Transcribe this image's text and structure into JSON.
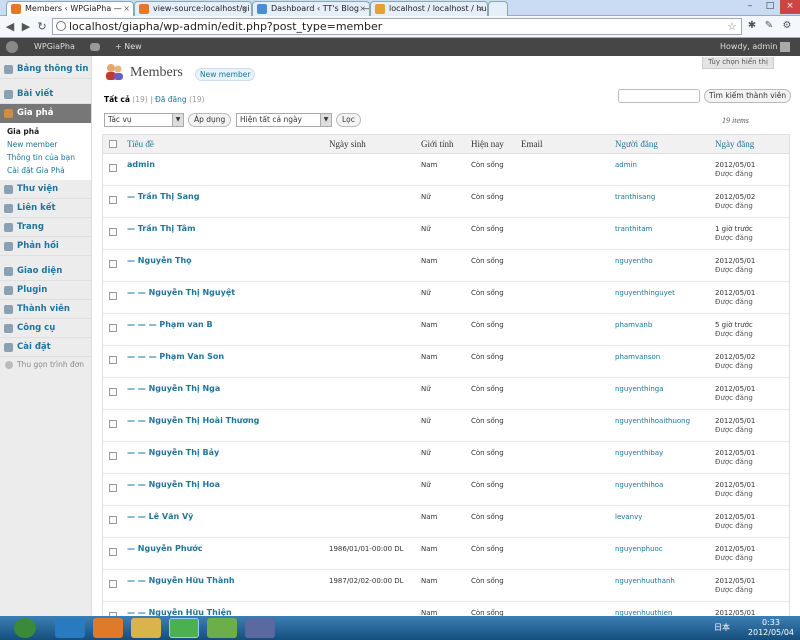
{
  "browser": {
    "tabs": [
      {
        "title": "Members ‹ WPGiaPha —",
        "color": "#e07a2a",
        "active": true
      },
      {
        "title": "view-source:localhost/gi",
        "color": "#e07a2a"
      },
      {
        "title": "Dashboard ‹ TT's Blog —",
        "color": "#4a8fd0"
      },
      {
        "title": "localhost / localhost / hu",
        "color": "#e8a030"
      }
    ],
    "url": "localhost/giapha/wp-admin/edit.php?post_type=member"
  },
  "admin_bar": {
    "site": "WPGiaPha",
    "new": "+ New",
    "howdy": "Howdy, admin"
  },
  "sidebar": {
    "items": [
      {
        "label": "Bảng thông tin"
      },
      {
        "label": "Bài viết"
      },
      {
        "label": "Gia phả"
      },
      {
        "label": "Thư viện"
      },
      {
        "label": "Liên kết"
      },
      {
        "label": "Trang"
      },
      {
        "label": "Phản hồi"
      },
      {
        "label": "Giao diện"
      },
      {
        "label": "Plugin"
      },
      {
        "label": "Thành viên"
      },
      {
        "label": "Công cụ"
      },
      {
        "label": "Cài đặt"
      }
    ],
    "submenu": [
      "Gia phả",
      "New member",
      "Thông tin của bạn",
      "Cài đặt Gia Phả"
    ],
    "collapse": "Thu gọn trình đơn"
  },
  "page": {
    "title": "Members",
    "add_new": "New member",
    "screen_options": "Tùy chọn hiển thị",
    "filter_all": "Tất cả",
    "filter_all_count": "(19)",
    "filter_sep": "|",
    "filter_pub": "Đã đăng",
    "filter_pub_count": "(19)",
    "search_button": "Tìm kiếm thành viên",
    "bulk_action": "Tác vụ",
    "apply": "Áp dụng",
    "date_filter": "Hiện tất cả ngày",
    "filter_btn": "Lọc",
    "items_count": "19 items"
  },
  "table": {
    "headers": {
      "title": "Tiêu đề",
      "birth": "Ngày sinh",
      "gender": "Giới tính",
      "status": "Hiện nay",
      "email": "Email",
      "author": "Người đăng",
      "date": "Ngày đăng"
    },
    "rows": [
      {
        "title": "admin",
        "birth": "",
        "gender": "Nam",
        "status": "Còn sống",
        "author": "admin",
        "date": "2012/05/01",
        "state": "Được đăng"
      },
      {
        "title": "— Trần Thị Sang",
        "birth": "",
        "gender": "Nữ",
        "status": "Còn sống",
        "author": "tranthisang",
        "date": "2012/05/02",
        "state": "Được đăng"
      },
      {
        "title": "— Trần Thị Tâm",
        "birth": "",
        "gender": "Nữ",
        "status": "Còn sống",
        "author": "tranthitam",
        "date": "1 giờ trước",
        "state": "Được đăng"
      },
      {
        "title": "— Nguyễn Thọ",
        "birth": "",
        "gender": "Nam",
        "status": "Còn sống",
        "author": "nguyentho",
        "date": "2012/05/01",
        "state": "Được đăng"
      },
      {
        "title": "— — Nguyễn Thị Nguyệt",
        "birth": "",
        "gender": "Nữ",
        "status": "Còn sống",
        "author": "nguyenthinguyet",
        "date": "2012/05/01",
        "state": "Được đăng"
      },
      {
        "title": "— — — Phạm van B",
        "birth": "",
        "gender": "Nam",
        "status": "Còn sống",
        "author": "phamvanb",
        "date": "5 giờ trước",
        "state": "Được đăng"
      },
      {
        "title": "— — — Phạm Van Son",
        "birth": "",
        "gender": "Nam",
        "status": "Còn sống",
        "author": "phamvanson",
        "date": "2012/05/02",
        "state": "Được đăng"
      },
      {
        "title": "— — Nguyễn Thị Nga",
        "birth": "",
        "gender": "Nữ",
        "status": "Còn sống",
        "author": "nguyenthinga",
        "date": "2012/05/01",
        "state": "Được đăng"
      },
      {
        "title": "— — Nguyễn Thị Hoài Thương",
        "birth": "",
        "gender": "Nữ",
        "status": "Còn sống",
        "author": "nguyenthihoaithuong",
        "date": "2012/05/01",
        "state": "Được đăng"
      },
      {
        "title": "— — Nguyễn Thị Bảy",
        "birth": "",
        "gender": "Nữ",
        "status": "Còn sống",
        "author": "nguyenthibay",
        "date": "2012/05/01",
        "state": "Được đăng"
      },
      {
        "title": "— — Nguyễn Thị Hoa",
        "birth": "",
        "gender": "Nữ",
        "status": "Còn sống",
        "author": "nguyenthihoa",
        "date": "2012/05/01",
        "state": "Được đăng"
      },
      {
        "title": "— — Lê Văn Vỹ",
        "birth": "",
        "gender": "Nam",
        "status": "Còn sống",
        "author": "levanvy",
        "date": "2012/05/01",
        "state": "Được đăng"
      },
      {
        "title": "— Nguyễn Phước",
        "birth": "1986/01/01-00:00 DL",
        "gender": "Nam",
        "status": "Còn sống",
        "author": "nguyenphuoc",
        "date": "2012/05/01",
        "state": "Được đăng"
      },
      {
        "title": "— — Nguyễn Hữu Thành",
        "birth": "1987/02/02-00:00 DL",
        "gender": "Nam",
        "status": "Còn sống",
        "author": "nguyenhuuthanh",
        "date": "2012/05/01",
        "state": "Được đăng"
      },
      {
        "title": "— — Nguyễn Hữu Thiện",
        "birth": "",
        "gender": "Nam",
        "status": "Còn sống",
        "author": "nguyenhuuthien",
        "date": "2012/05/01",
        "state": ""
      }
    ]
  },
  "taskbar": {
    "lang": "日本",
    "time": "0:33",
    "date": "2012/05/04"
  },
  "colors": {
    "link": "#21759b",
    "admin_bar": "#464646",
    "taskbar": "#1b5a8a"
  }
}
